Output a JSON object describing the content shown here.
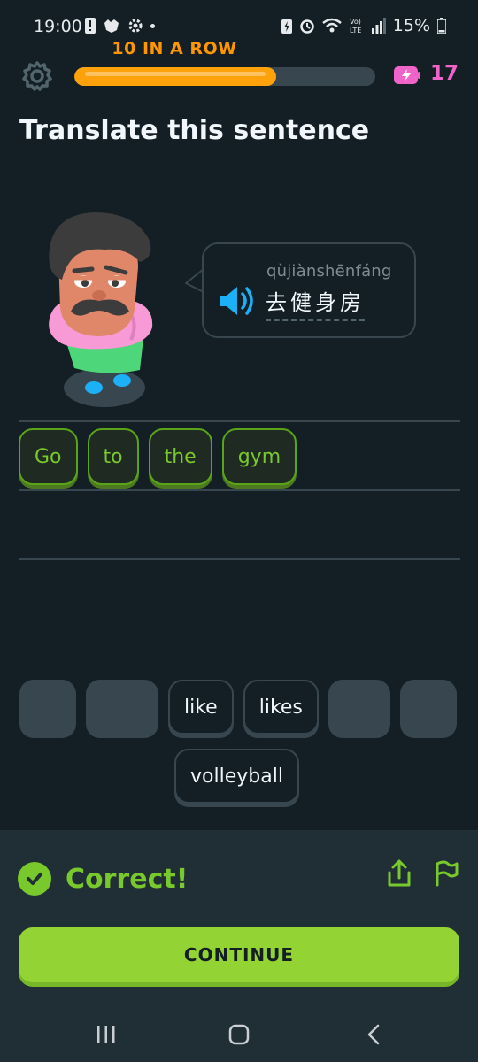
{
  "status_bar": {
    "time": "19:00",
    "battery": "15%",
    "icons": [
      "alert-icon",
      "pet-icon",
      "settings-icon",
      "dot-icon",
      "battery-saver-icon",
      "alarm-icon",
      "wifi-icon",
      "volte-icon",
      "signal-icon",
      "battery-icon"
    ]
  },
  "header": {
    "streak_label": "10 IN A ROW",
    "progress": 0.67,
    "energy_count": "17",
    "colors": {
      "progress": "#ffa10a",
      "energy": "#f063c8",
      "streak": "#ff9600"
    }
  },
  "lesson": {
    "instruction": "Translate this sentence",
    "pinyin": "qùjiànshēnfáng",
    "hanzi": "去健身房"
  },
  "answer": {
    "words": [
      "Go",
      "to",
      "the",
      "gym"
    ]
  },
  "word_bank": {
    "row1": [
      {
        "type": "empty"
      },
      {
        "type": "empty"
      },
      {
        "type": "word",
        "label": "like"
      },
      {
        "type": "word",
        "label": "likes"
      },
      {
        "type": "empty"
      },
      {
        "type": "empty"
      }
    ],
    "row2": [
      {
        "type": "word",
        "label": "volleyball"
      }
    ]
  },
  "result": {
    "message": "Correct!",
    "continue_label": "CONTINUE",
    "colors": {
      "success": "#79c82c",
      "button": "#93d333"
    }
  }
}
